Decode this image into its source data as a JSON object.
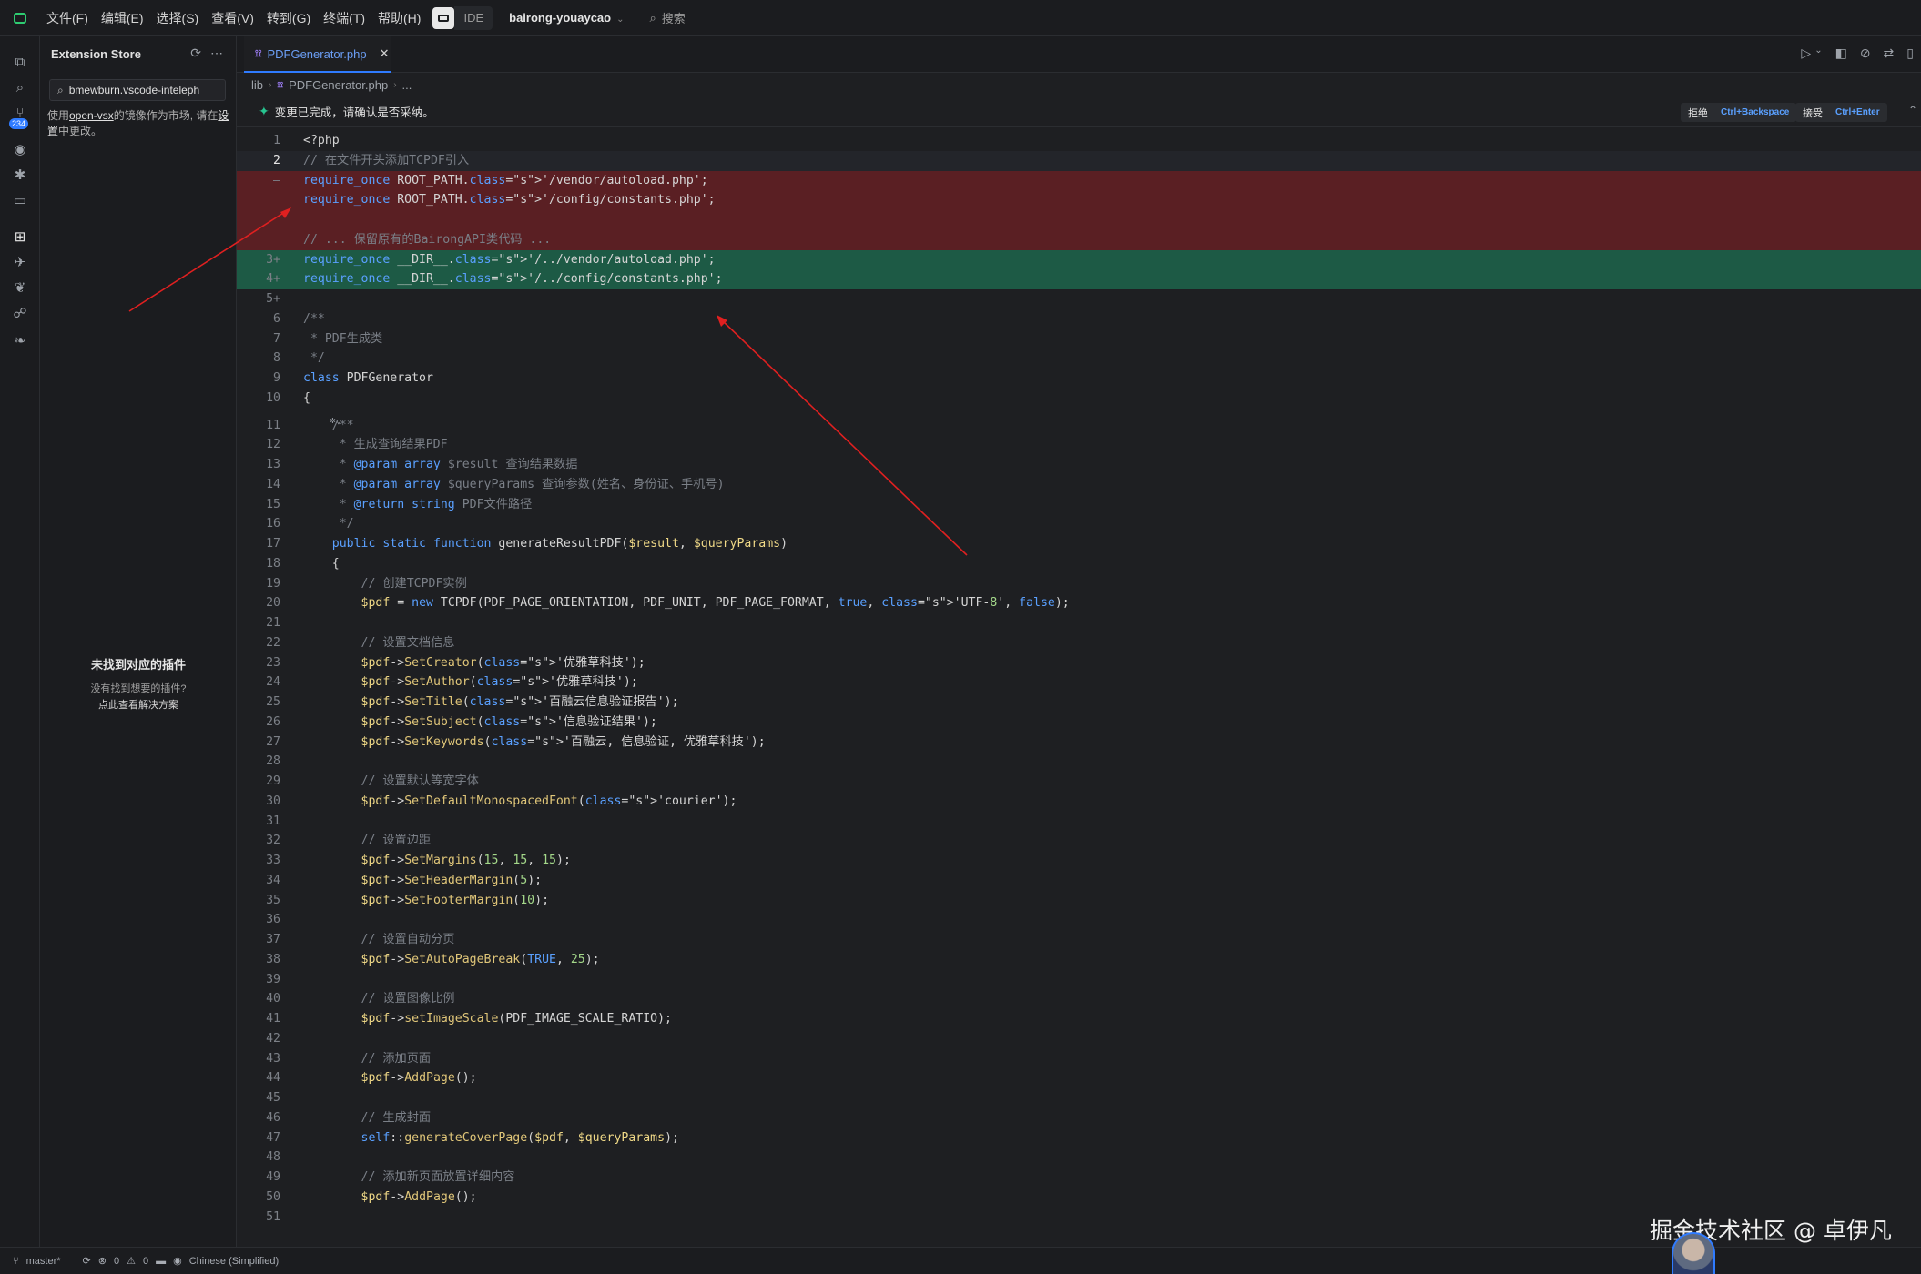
{
  "menu": [
    "文件(F)",
    "编辑(E)",
    "选择(S)",
    "查看(V)",
    "转到(G)",
    "终端(T)",
    "帮助(H)"
  ],
  "ide_label": "IDE",
  "workspace": "bairong-youaycao",
  "top_search": "搜索",
  "activity_badge": "234",
  "sidebar": {
    "title": "Extension Store",
    "search_value": "bmewburn.vscode-inteleph",
    "note_prefix": "使用",
    "note_link": "open-vsx",
    "note_mid": "的镜像作为市场, 请在",
    "note_link2": "设置",
    "note_suffix": "中更改。",
    "empty_title": "未找到对应的插件",
    "empty_sub": "没有找到想要的插件?",
    "empty_link": "点此查看解决方案"
  },
  "tab": {
    "icon": "php",
    "name": "PDFGenerator.php"
  },
  "breadcrumb": {
    "folder": "lib",
    "icon": "php",
    "file": "PDFGenerator.php",
    "more": "..."
  },
  "banner": {
    "message": "变更已完成，请确认是否采纳。",
    "reject_label": "拒绝",
    "reject_key": "Ctrl+Backspace",
    "accept_label": "接受",
    "accept_key": "Ctrl+Enter"
  },
  "code_lines": [
    {
      "n": "1",
      "t": "<?php"
    },
    {
      "n": "2",
      "t": "// 在文件开头添加TCPDF引入",
      "hl": true
    },
    {
      "n": "—",
      "t": "require_once ROOT_PATH.'/vendor/autoload.php';",
      "state": "removed"
    },
    {
      "n": "",
      "t": "require_once ROOT_PATH.'/config/constants.php';",
      "state": "removed"
    },
    {
      "n": "",
      "t": "",
      "state": "removed"
    },
    {
      "n": "",
      "t": "// ... 保留原有的BairongAPI类代码 ...",
      "state": "removed"
    },
    {
      "n": "3+",
      "t": "require_once __DIR__.'/../vendor/autoload.php';",
      "state": "added"
    },
    {
      "n": "4+",
      "t": "require_once __DIR__.'/../config/constants.php';",
      "state": "added"
    },
    {
      "n": "5+",
      "t": ""
    },
    {
      "n": "6",
      "t": "/**"
    },
    {
      "n": "7",
      "t": " * PDF生成类"
    },
    {
      "n": "8",
      "t": " */"
    },
    {
      "n": "9",
      "t": "class PDFGenerator"
    },
    {
      "n": "10",
      "t": "{"
    },
    {
      "n": "11",
      "t": "    /**"
    },
    {
      "n": "12",
      "t": "     * 生成查询结果PDF"
    },
    {
      "n": "13",
      "t": "     * @param array $result 查询结果数据"
    },
    {
      "n": "14",
      "t": "     * @param array $queryParams 查询参数(姓名、身份证、手机号)"
    },
    {
      "n": "15",
      "t": "     * @return string PDF文件路径"
    },
    {
      "n": "16",
      "t": "     */"
    },
    {
      "n": "17",
      "t": "    public static function generateResultPDF($result, $queryParams)"
    },
    {
      "n": "18",
      "t": "    {"
    },
    {
      "n": "19",
      "t": "        // 创建TCPDF实例"
    },
    {
      "n": "20",
      "t": "        $pdf = new TCPDF(PDF_PAGE_ORIENTATION, PDF_UNIT, PDF_PAGE_FORMAT, true, 'UTF-8', false);"
    },
    {
      "n": "21",
      "t": ""
    },
    {
      "n": "22",
      "t": "        // 设置文档信息"
    },
    {
      "n": "23",
      "t": "        $pdf->SetCreator('优雅草科技');"
    },
    {
      "n": "24",
      "t": "        $pdf->SetAuthor('优雅草科技');"
    },
    {
      "n": "25",
      "t": "        $pdf->SetTitle('百融云信息验证报告');"
    },
    {
      "n": "26",
      "t": "        $pdf->SetSubject('信息验证结果');"
    },
    {
      "n": "27",
      "t": "        $pdf->SetKeywords('百融云, 信息验证, 优雅草科技');"
    },
    {
      "n": "28",
      "t": ""
    },
    {
      "n": "29",
      "t": "        // 设置默认等宽字体"
    },
    {
      "n": "30",
      "t": "        $pdf->SetDefaultMonospacedFont('courier');"
    },
    {
      "n": "31",
      "t": ""
    },
    {
      "n": "32",
      "t": "        // 设置边距"
    },
    {
      "n": "33",
      "t": "        $pdf->SetMargins(15, 15, 15);"
    },
    {
      "n": "34",
      "t": "        $pdf->SetHeaderMargin(5);"
    },
    {
      "n": "35",
      "t": "        $pdf->SetFooterMargin(10);"
    },
    {
      "n": "36",
      "t": ""
    },
    {
      "n": "37",
      "t": "        // 设置自动分页"
    },
    {
      "n": "38",
      "t": "        $pdf->SetAutoPageBreak(TRUE, 25);"
    },
    {
      "n": "39",
      "t": ""
    },
    {
      "n": "40",
      "t": "        // 设置图像比例"
    },
    {
      "n": "41",
      "t": "        $pdf->setImageScale(PDF_IMAGE_SCALE_RATIO);"
    },
    {
      "n": "42",
      "t": ""
    },
    {
      "n": "43",
      "t": "        // 添加页面"
    },
    {
      "n": "44",
      "t": "        $pdf->AddPage();"
    },
    {
      "n": "45",
      "t": ""
    },
    {
      "n": "46",
      "t": "        // 生成封面"
    },
    {
      "n": "47",
      "t": "        self::generateCoverPage($pdf, $queryParams);"
    },
    {
      "n": "48",
      "t": ""
    },
    {
      "n": "49",
      "t": "        // 添加新页面放置详细内容"
    },
    {
      "n": "50",
      "t": "        $pdf->AddPage();"
    },
    {
      "n": "51",
      "t": ""
    }
  ],
  "status": {
    "branch": "master*",
    "errors": "0",
    "warnings": "0",
    "language": "Chinese (Simplified)"
  },
  "watermark": "掘金技术社区 @ 卓伊凡",
  "colors": {
    "removed_bg": "#5a1f23",
    "added_bg": "#1d5a45",
    "accent": "#2f7bff",
    "arrow": "#e02020"
  }
}
